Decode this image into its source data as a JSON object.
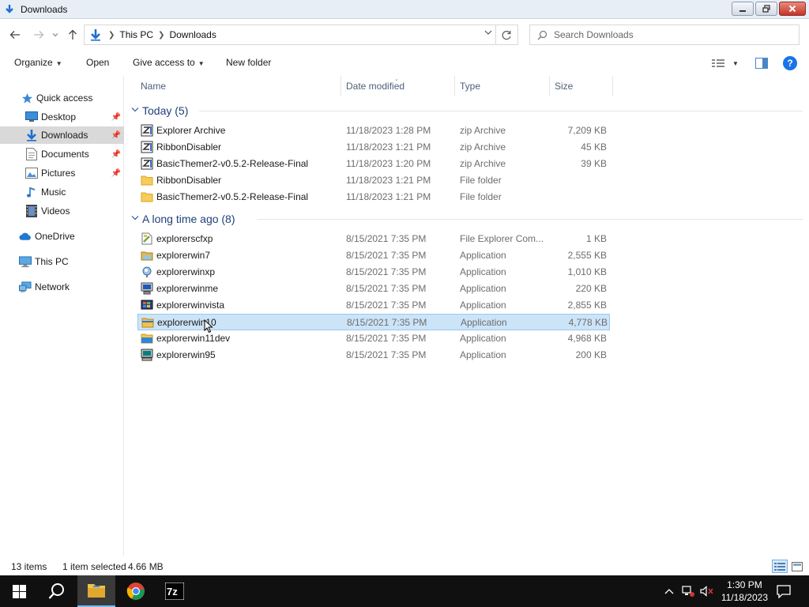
{
  "window": {
    "title": "Downloads"
  },
  "address": {
    "crumbs": [
      "This PC",
      "Downloads"
    ],
    "search_placeholder": "Search Downloads"
  },
  "toolbar": {
    "organize": "Organize",
    "open": "Open",
    "give_access": "Give access to",
    "new_folder": "New folder"
  },
  "nav": {
    "quick_access": "Quick access",
    "desktop": "Desktop",
    "downloads": "Downloads",
    "documents": "Documents",
    "pictures": "Pictures",
    "music": "Music",
    "videos": "Videos",
    "onedrive": "OneDrive",
    "this_pc": "This PC",
    "network": "Network"
  },
  "columns": {
    "name": "Name",
    "date": "Date modified",
    "type": "Type",
    "size": "Size"
  },
  "groups": {
    "today": "Today (5)",
    "old": "A long time ago (8)"
  },
  "files_today": [
    {
      "name": "Explorer Archive",
      "date": "11/18/2023 1:28 PM",
      "type": "zip Archive",
      "size": "7,209 KB",
      "icon": "zip-archive-icon"
    },
    {
      "name": "RibbonDisabler",
      "date": "11/18/2023 1:21 PM",
      "type": "zip Archive",
      "size": "45 KB",
      "icon": "zip-archive-icon"
    },
    {
      "name": "BasicThemer2-v0.5.2-Release-Final",
      "date": "11/18/2023 1:20 PM",
      "type": "zip Archive",
      "size": "39 KB",
      "icon": "zip-archive-icon"
    },
    {
      "name": "RibbonDisabler",
      "date": "11/18/2023 1:21 PM",
      "type": "File folder",
      "size": "",
      "icon": "folder-icon"
    },
    {
      "name": "BasicThemer2-v0.5.2-Release-Final",
      "date": "11/18/2023 1:21 PM",
      "type": "File folder",
      "size": "",
      "icon": "folder-icon"
    }
  ],
  "files_old": [
    {
      "name": "explorerscfxp",
      "date": "8/15/2021 7:35 PM",
      "type": "File Explorer Com...",
      "size": "1 KB",
      "icon": "scf-command-icon"
    },
    {
      "name": "explorerwin7",
      "date": "8/15/2021 7:35 PM",
      "type": "Application",
      "size": "2,555 KB",
      "icon": "explorer-win7-icon"
    },
    {
      "name": "explorerwinxp",
      "date": "8/15/2021 7:35 PM",
      "type": "Application",
      "size": "1,010 KB",
      "icon": "explorer-winxp-icon"
    },
    {
      "name": "explorerwinme",
      "date": "8/15/2021 7:35 PM",
      "type": "Application",
      "size": "220 KB",
      "icon": "explorer-winme-icon"
    },
    {
      "name": "explorerwinvista",
      "date": "8/15/2021 7:35 PM",
      "type": "Application",
      "size": "2,855 KB",
      "icon": "explorer-winvista-icon"
    },
    {
      "name": "explorerwin10",
      "date": "8/15/2021 7:35 PM",
      "type": "Application",
      "size": "4,778 KB",
      "icon": "explorer-win10-icon"
    },
    {
      "name": "explorerwin11dev",
      "date": "8/15/2021 7:35 PM",
      "type": "Application",
      "size": "4,968 KB",
      "icon": "explorer-win11-icon"
    },
    {
      "name": "explorerwin95",
      "date": "8/15/2021 7:35 PM",
      "type": "Application",
      "size": "200 KB",
      "icon": "explorer-win95-icon"
    }
  ],
  "status": {
    "items": "13 items",
    "selected": "1 item selected",
    "selected_size": "4.66 MB"
  },
  "taskbar": {
    "time": "1:30 PM",
    "date": "11/18/2023"
  },
  "colors": {
    "selection": "#cce4f7",
    "group_header": "#1e3f7a",
    "taskbar": "#101010",
    "accent": "#1a73e8"
  }
}
